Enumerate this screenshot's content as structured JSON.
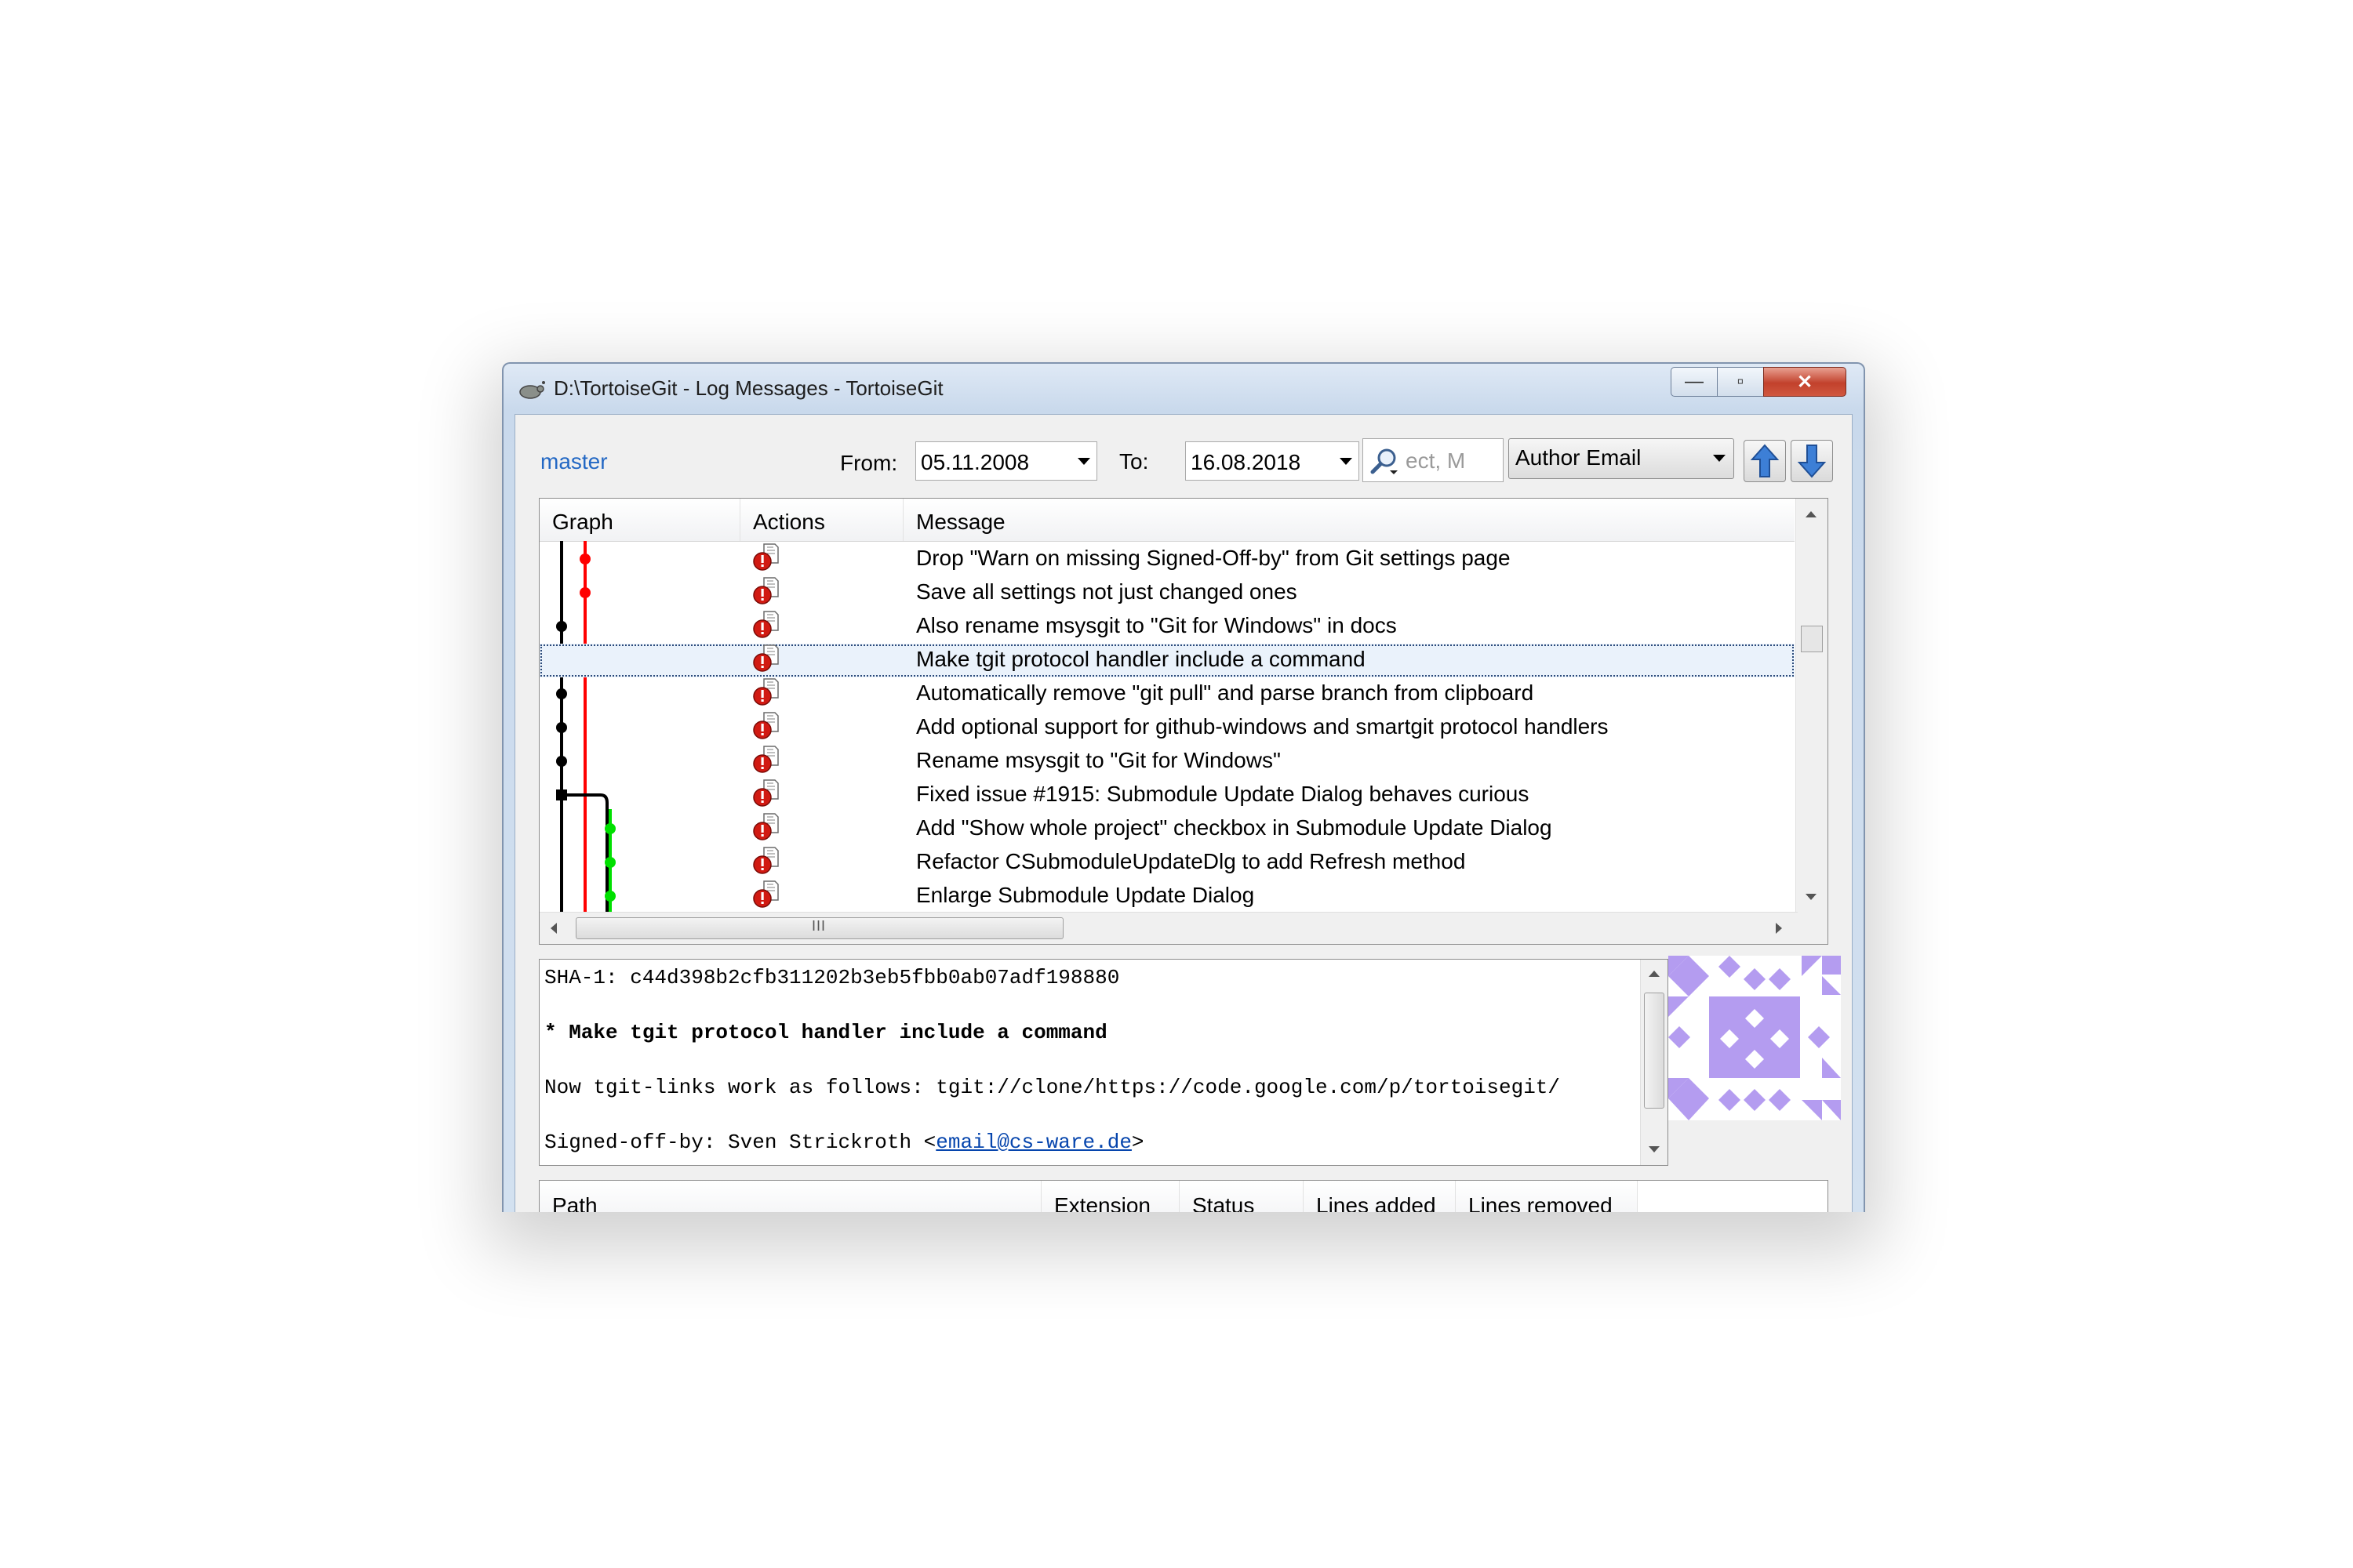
{
  "window": {
    "title": "D:\\TortoiseGit - Log Messages - TortoiseGit",
    "minimize_label": "—",
    "maximize_label": "▫",
    "close_label": "✕"
  },
  "toolbar": {
    "branch": "master",
    "from_label": "From:",
    "from_value": "05.11.2008",
    "to_label": "To:",
    "to_value": "16.08.2018",
    "search_placeholder": "ect, M",
    "filter_field": "Author Email"
  },
  "log": {
    "columns": [
      "Graph",
      "Actions",
      "Message"
    ],
    "rows": [
      {
        "message": "Drop \"Warn on missing Signed-Off-by\" from Git settings page"
      },
      {
        "message": "Save all settings not just changed ones"
      },
      {
        "message": "Also rename msysgit to \"Git for Windows\" in docs"
      },
      {
        "message": "Make tgit protocol handler include a command"
      },
      {
        "message": "Automatically remove \"git pull\" and parse branch from clipboard"
      },
      {
        "message": "Add optional support for github-windows and smartgit protocol handlers"
      },
      {
        "message": "Rename msysgit to \"Git for Windows\""
      },
      {
        "message": "Fixed issue #1915: Submodule Update Dialog behaves curious"
      },
      {
        "message": "Add \"Show whole project\" checkbox in Submodule Update Dialog"
      },
      {
        "message": "Refactor CSubmoduleUpdateDlg to add Refresh method"
      },
      {
        "message": "Enlarge Submodule Update Dialog"
      }
    ],
    "selected_index": 3,
    "scroll_grip": "III"
  },
  "details": {
    "sha_line": "SHA-1: c44d398b2cfb311202b3eb5fbb0ab07adf198880",
    "subject": "* Make tgit protocol handler include a command",
    "body": "Now tgit-links work as follows: tgit://clone/https://code.google.com/p/tortoisegit/",
    "signoff_prefix": "Signed-off-by: Sven Strickroth <",
    "signoff_email": "email@cs-ware.de",
    "signoff_suffix": ">"
  },
  "files": {
    "columns": [
      "Path",
      "Extension",
      "Status",
      "Lines added",
      "Lines removed"
    ]
  },
  "colors": {
    "branch_link": "#2368c4",
    "graph_black": "#000000",
    "graph_red": "#ff0000",
    "graph_green": "#00e000",
    "avatar_purple": "#b49cf0",
    "close_button": "#c2412c"
  },
  "icons": {
    "app": "tortoise-icon",
    "action": "modified-file-alert-icon",
    "search": "search-icon",
    "up": "arrow-up-icon",
    "down": "arrow-down-icon"
  }
}
